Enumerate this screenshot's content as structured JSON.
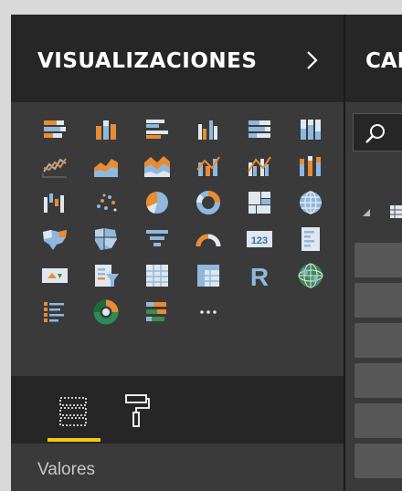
{
  "visualizations": {
    "title": "VISUALIZACIONES",
    "expand_icon": "chevron-right-icon",
    "icons": [
      {
        "name": "stacked-bar-chart-icon"
      },
      {
        "name": "stacked-column-chart-icon"
      },
      {
        "name": "clustered-bar-chart-icon"
      },
      {
        "name": "clustered-column-chart-icon"
      },
      {
        "name": "100-stacked-bar-chart-icon"
      },
      {
        "name": "100-stacked-column-chart-icon"
      },
      {
        "name": "line-chart-icon"
      },
      {
        "name": "area-chart-icon"
      },
      {
        "name": "stacked-area-chart-icon"
      },
      {
        "name": "line-and-stacked-column-chart-icon"
      },
      {
        "name": "line-and-clustered-column-chart-icon"
      },
      {
        "name": "ribbon-chart-icon"
      },
      {
        "name": "waterfall-chart-icon"
      },
      {
        "name": "scatter-chart-icon"
      },
      {
        "name": "pie-chart-icon"
      },
      {
        "name": "donut-chart-icon"
      },
      {
        "name": "treemap-icon"
      },
      {
        "name": "map-icon"
      },
      {
        "name": "filled-map-icon"
      },
      {
        "name": "shape-map-icon"
      },
      {
        "name": "funnel-icon"
      },
      {
        "name": "gauge-icon"
      },
      {
        "name": "card-icon",
        "text": "123"
      },
      {
        "name": "multi-row-card-icon"
      },
      {
        "name": "kpi-icon"
      },
      {
        "name": "slicer-icon"
      },
      {
        "name": "table-icon"
      },
      {
        "name": "matrix-icon"
      },
      {
        "name": "r-visual-icon",
        "text": "R"
      },
      {
        "name": "arcgis-map-icon"
      },
      {
        "name": "bullet-list-visual-icon"
      },
      {
        "name": "donut-custom-visual-icon"
      },
      {
        "name": "horizontal-bar-custom-visual-icon"
      },
      {
        "name": "more-visuals-icon",
        "text": "···"
      }
    ]
  },
  "tabs": [
    {
      "name": "fields-tab-icon",
      "active": true
    },
    {
      "name": "format-paint-roller-icon",
      "active": false
    }
  ],
  "well": {
    "label": "Valores"
  },
  "fields": {
    "title": "CAMPOS",
    "search_icon": "search-icon"
  },
  "colors": {
    "accent": "#f2c811",
    "header_bg": "#262626",
    "pane_bg": "#3a3a3a",
    "icon_orange": "#e88c33",
    "icon_blue": "#8fb8de",
    "icon_light": "#dfe7ef"
  }
}
